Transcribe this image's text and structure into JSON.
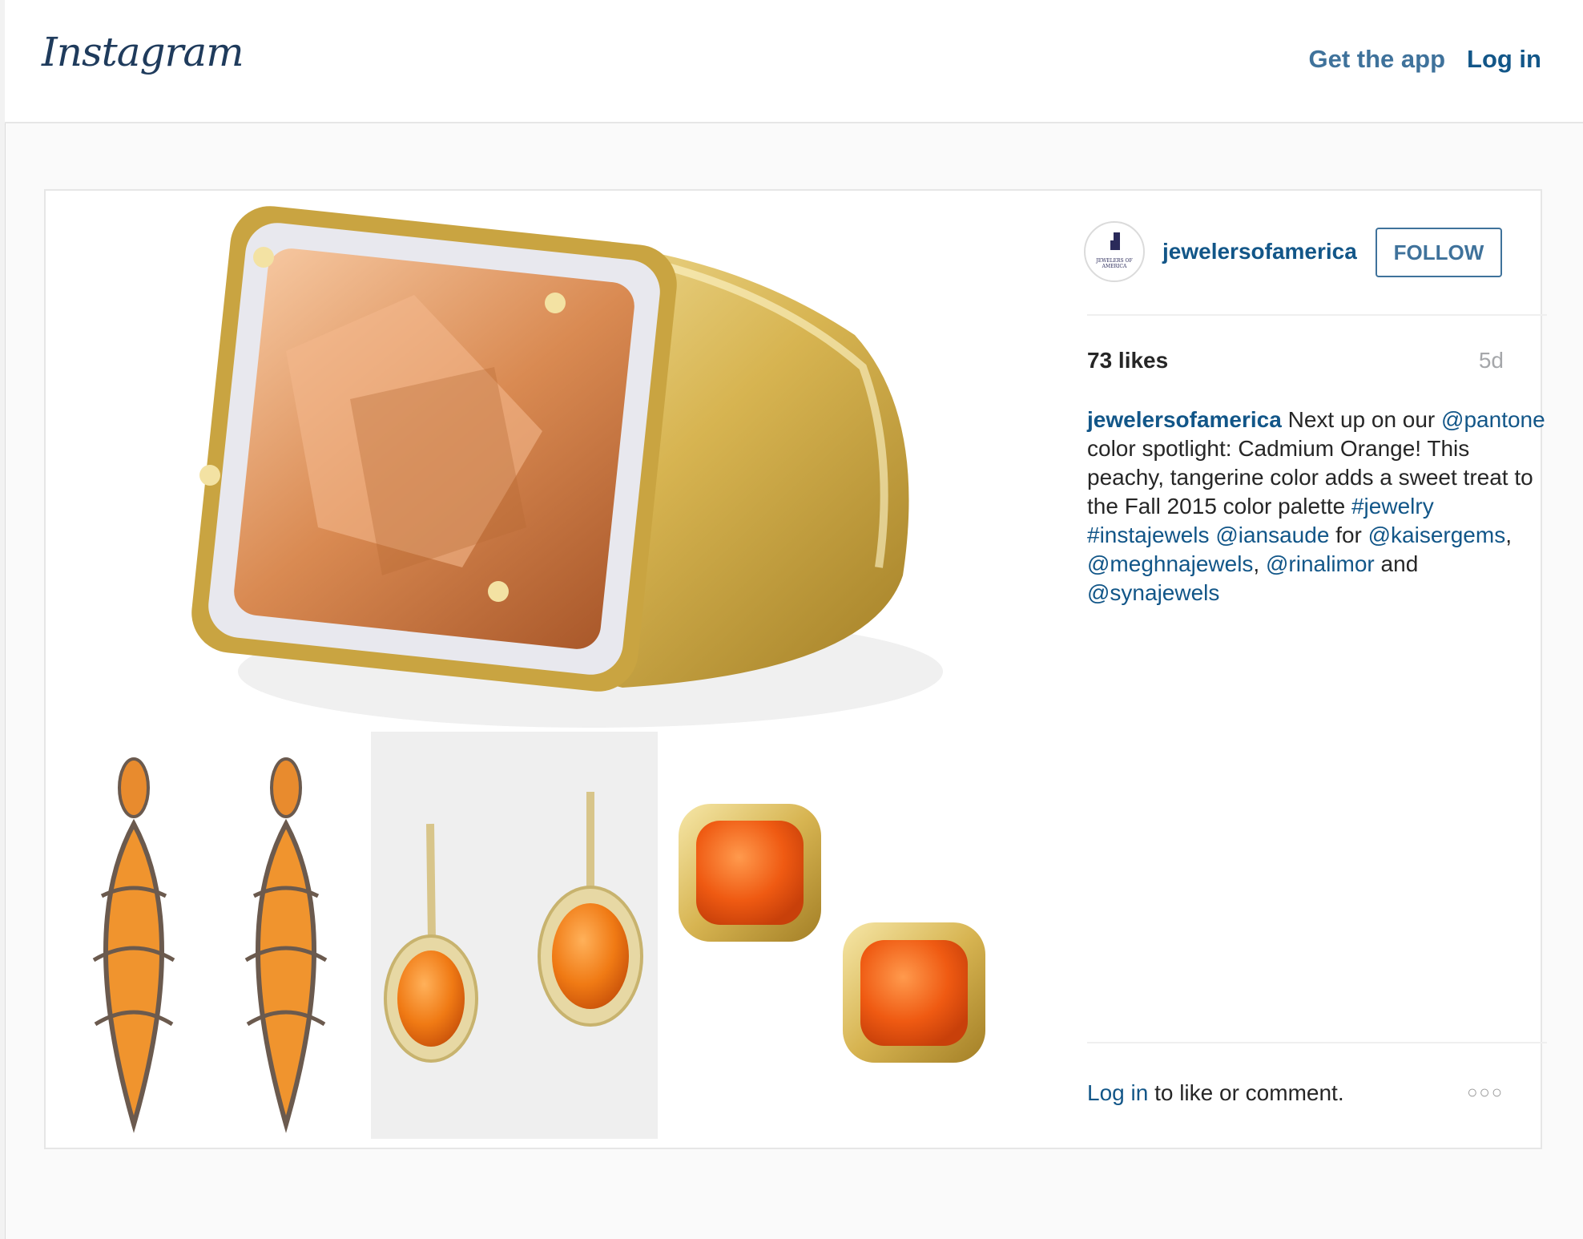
{
  "header": {
    "logo": "Instagram",
    "get_app": "Get the app",
    "log_in": "Log in"
  },
  "post": {
    "username": "jewelersofamerica",
    "avatar_text": "JEWELERS OF AMERICA",
    "follow": "FOLLOW",
    "likes": "73 likes",
    "age": "5d",
    "caption": {
      "username": "jewelersofamerica",
      "t1": " Next up on our ",
      "m_pantone": "@pantone",
      "t2": " color spotlight: Cadmium Orange! This peachy, tangerine color adds a sweet treat to the Fall 2015 color palette ",
      "h_jewelry": "#jewelry",
      "sp1": " ",
      "h_instajewels": "#instajewels",
      "sp2": " ",
      "m_iansaude": "@iansaude",
      "t3": " for ",
      "m_kaisergems": "@kaisergems",
      "c1": ", ",
      "m_meghnajewels": "@meghnajewels",
      "c2": ", ",
      "m_rinalimor": "@rinalimor",
      "t4": " and ",
      "m_synajewels": "@synajewels"
    },
    "login_link": "Log in",
    "login_rest": " to like or comment.",
    "more": "○○○"
  },
  "colors": {
    "brand_blue": "#125688",
    "link_blue": "#3f729b",
    "gold": "#e3c25a",
    "orange": "#f28a1d"
  },
  "icons": [
    "more-options-icon"
  ]
}
